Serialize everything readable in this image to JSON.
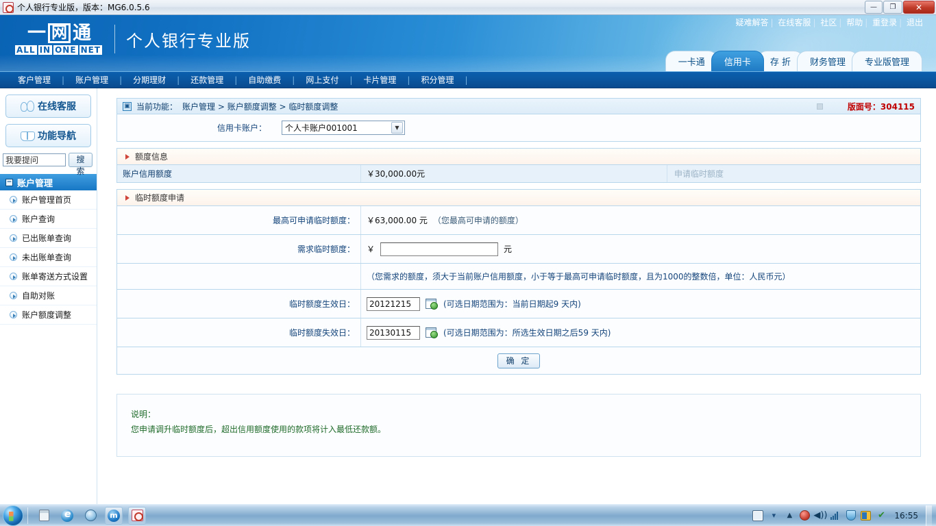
{
  "window": {
    "title": "个人银行专业版，版本：MG6.0.5.6",
    "app_icon": "bank-app-icon",
    "minimize_label": "—",
    "restore_label": "❐",
    "close_label": "✕"
  },
  "header": {
    "top_links": [
      "疑难解答",
      "在线客服",
      "社区",
      "帮助",
      "重登录",
      "退出"
    ],
    "separator": "|",
    "logo": {
      "char1": "一",
      "char2": "网",
      "char3": "通",
      "english": [
        "ALL",
        "IN",
        "ONE",
        "NET"
      ],
      "product_name": "个人银行专业版"
    },
    "tabs": [
      {
        "label": "一卡通",
        "active": false
      },
      {
        "label": "信用卡",
        "active": true
      },
      {
        "label": "存 折",
        "active": false
      },
      {
        "label": "财务管理",
        "active": false
      },
      {
        "label": "专业版管理",
        "active": false
      }
    ]
  },
  "nav": {
    "items": [
      "客户管理",
      "账户管理",
      "分期理财",
      "还款管理",
      "自助缴费",
      "网上支付",
      "卡片管理",
      "积分管理"
    ],
    "separator": "|"
  },
  "sidebar": {
    "buttons": [
      {
        "label": "在线客服",
        "icon": "people-icon"
      },
      {
        "label": "功能导航",
        "icon": "book-icon"
      }
    ],
    "search": {
      "value": "我要提问",
      "placeholder": "我要提问",
      "button_label": "搜索"
    },
    "group_title": "账户管理",
    "group_toggle": "−",
    "items": [
      "账户管理首页",
      "账户查询",
      "已出账单查询",
      "未出账单查询",
      "账单寄送方式设置",
      "自助对账",
      "账户额度调整"
    ]
  },
  "breadcrumb": {
    "icon": "window-icon",
    "prefix": "当前功能：",
    "path": "账户管理 > 账户额度调整 > 临时额度调整",
    "version_label": "版面号：304115"
  },
  "account": {
    "label": "信用卡账户：",
    "selected": "个人卡账户001001",
    "options": [
      "个人卡账户001001"
    ],
    "arrow": "▼"
  },
  "limit_info": {
    "section_title": "额度信息",
    "row_label": "账户信用额度",
    "row_value": "￥30,000.00元",
    "action_link": "申请临时额度"
  },
  "temp_apply": {
    "section_title": "临时额度申请",
    "max_label": "最高可申请临时额度：",
    "max_value": "￥63,000.00 元",
    "max_note": "（您最高可申请的额度）",
    "need_label": "需求临时额度：",
    "currency_symbol": "￥",
    "need_value": "",
    "need_unit": "元",
    "rule_note": "（您需求的额度，须大于当前账户信用额度，小于等于最高可申请临时额度，且为1000的整数倍，单位：人民币元）",
    "start_label": "临时额度生效日：",
    "start_value": "20121215",
    "start_note": "(可选日期范围为：当前日期起9 天内)",
    "end_label": "临时额度失效日：",
    "end_value": "20130115",
    "end_note": "(可选日期范围为：所选生效日期之后59 天内)",
    "calendar_icon": "calendar-icon",
    "submit_label": "确 定"
  },
  "description": {
    "title": "说明：",
    "text": "您申请调升临时额度后，超出信用额度使用的款项将计入最低还款额。"
  },
  "taskbar": {
    "start_icon": "windows-start-orb",
    "quick_launch": [
      {
        "name": "calculator-icon"
      },
      {
        "name": "internet-explorer-icon"
      },
      {
        "name": "clock-icon"
      }
    ],
    "windows": [
      {
        "name": "maxthon-browser-icon",
        "glyph": "m"
      },
      {
        "name": "bank-app-icon"
      }
    ],
    "tray": [
      {
        "name": "keyboard-icon"
      },
      {
        "name": "ime-icon",
        "glyph": "▾"
      },
      {
        "name": "show-hidden-icons-chevron",
        "glyph": "▲"
      },
      {
        "name": "block-icon"
      },
      {
        "name": "volume-icon",
        "glyph": "🔊"
      },
      {
        "name": "network-signal-icon"
      },
      {
        "name": "security-shield-icon"
      },
      {
        "name": "office-icon"
      },
      {
        "name": "antivirus-check-icon",
        "glyph": "✔"
      }
    ],
    "clock": "16:55"
  },
  "colors": {
    "accent": "#0a63b4",
    "nav_bg": "#0b56a0",
    "version_red": "#c00000",
    "note_green": "#1f6b2a",
    "panel_border": "#b9d7ec"
  }
}
